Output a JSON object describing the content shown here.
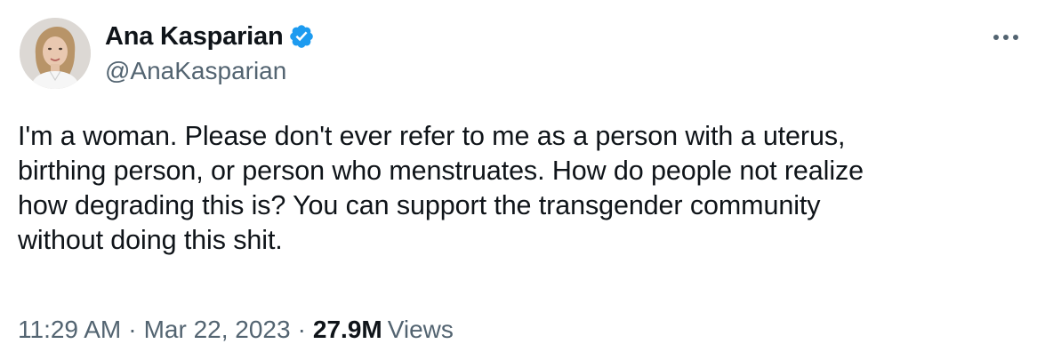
{
  "author": {
    "display_name": "Ana Kasparian",
    "handle": "@AnaKasparian",
    "verified": true,
    "avatar_icon": "profile-photo"
  },
  "tweet": {
    "text": "I'm a woman. Please don't ever refer to me as a person with a uterus,\nbirthing person, or person who menstruates. How do people not realize\nhow degrading this is? You can support the transgender community\nwithout doing this shit."
  },
  "meta": {
    "time": "11:29 AM",
    "separator": "·",
    "date": "Mar 22, 2023",
    "views_count": "27.9M",
    "views_label": "Views"
  },
  "colors": {
    "verified_blue": "#1d9bf0",
    "secondary_text": "#536471",
    "primary_text": "#0f1419"
  },
  "icons": {
    "more": "more-horizontal-icon",
    "verified": "verified-badge-icon"
  }
}
